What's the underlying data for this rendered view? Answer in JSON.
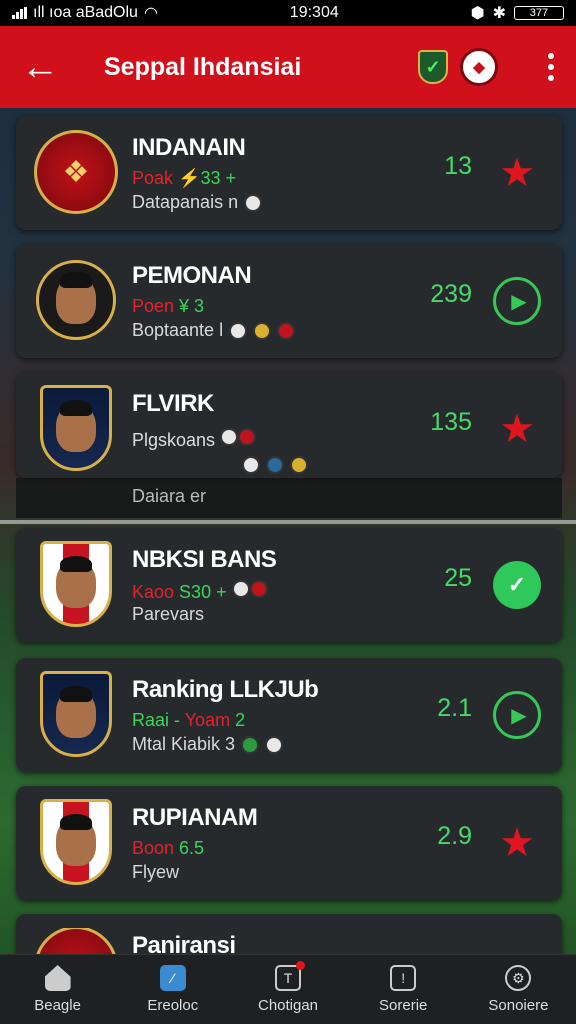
{
  "status": {
    "carrier": "ıll ıoa aBadOlu",
    "time": "19:304",
    "battery": "377"
  },
  "header": {
    "title": "Seppal Ihdansiai",
    "back_icon": "arrow-left-icon",
    "menu_icon": "more-vert-icon"
  },
  "rows": [
    {
      "name": "INDANAIN",
      "sub": [
        {
          "t": "Poak ",
          "c": "red"
        },
        {
          "t": "⚡33 +",
          "c": "green"
        }
      ],
      "meta": "Datapanais n",
      "score": "13",
      "action": "star"
    },
    {
      "name": "PEMONAN",
      "sub": [
        {
          "t": "Poen ",
          "c": "red"
        },
        {
          "t": "¥ 3",
          "c": "green"
        }
      ],
      "meta": "Boptaante l",
      "score": "239",
      "action": "play"
    },
    {
      "name": "FLVIRK",
      "sub": [
        {
          "t": "Plgskoans",
          "c": "plain"
        }
      ],
      "meta": "",
      "score": "135",
      "action": "star"
    },
    {
      "name": "NBKSI BANS",
      "sub": [
        {
          "t": "Kaoo ",
          "c": "red"
        },
        {
          "t": "S30 +",
          "c": "green"
        }
      ],
      "meta": "Parevars",
      "score": "25",
      "action": "check"
    },
    {
      "name": "Ranking LLKJUb",
      "sub": [
        {
          "t": "Raai - ",
          "c": "green"
        },
        {
          "t": "Yoam ",
          "c": "red"
        },
        {
          "t": "2",
          "c": "green"
        }
      ],
      "meta": "Mtal Kiabik   3",
      "score": "2.1",
      "action": "play"
    },
    {
      "name": "RUPIANAM",
      "sub": [
        {
          "t": "Boon ",
          "c": "red"
        },
        {
          "t": "6.5",
          "c": "green"
        }
      ],
      "meta": "Flyew",
      "score": "2.9",
      "action": "star"
    },
    {
      "name": "Paniransi",
      "sub": [],
      "meta": "",
      "score": "",
      "action": ""
    }
  ],
  "ghost_text": "Daiara er",
  "nav": [
    {
      "label": "Beagle",
      "icon": "home-icon"
    },
    {
      "label": "Ereoloc",
      "icon": "chart-icon"
    },
    {
      "label": "Chotigan",
      "icon": "tv-icon"
    },
    {
      "label": "Sorerie",
      "icon": "phone-icon"
    },
    {
      "label": "Sonoiere",
      "icon": "settings-icon"
    }
  ]
}
